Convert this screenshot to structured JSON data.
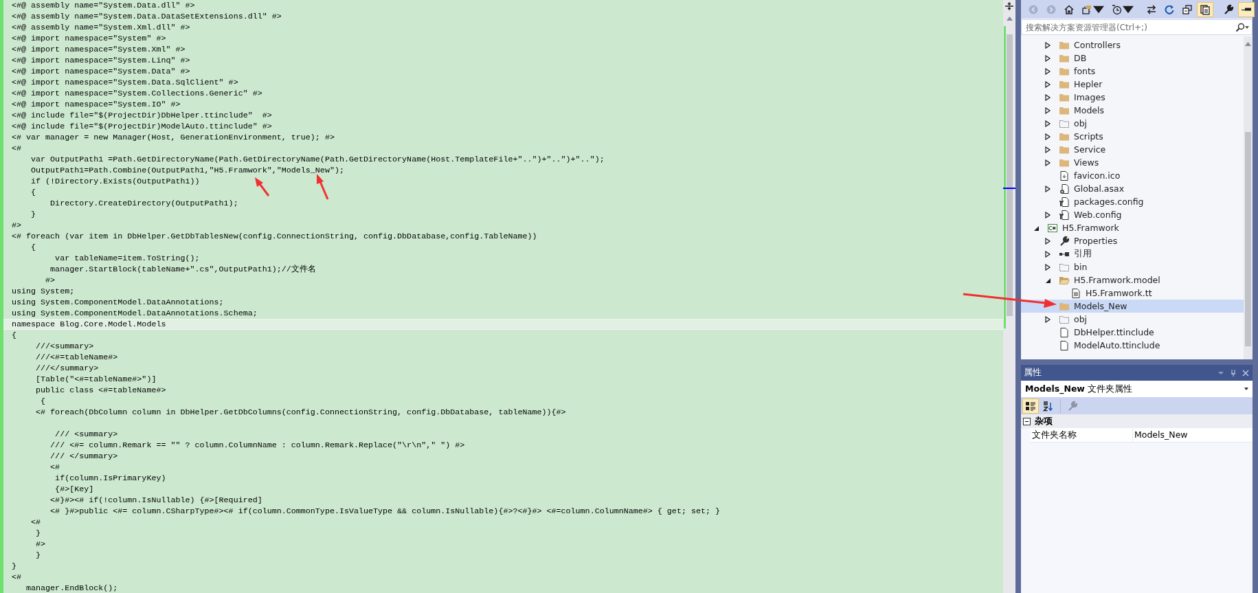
{
  "editor": {
    "lines": [
      {
        "text": "<#@ assembly name=\"System.Data.dll\" #>",
        "current": false
      },
      {
        "text": "<#@ assembly name=\"System.Data.DataSetExtensions.dll\" #>",
        "current": false
      },
      {
        "text": "<#@ assembly name=\"System.Xml.dll\" #>",
        "current": false
      },
      {
        "text": "<#@ import namespace=\"System\" #>",
        "current": false
      },
      {
        "text": "<#@ import namespace=\"System.Xml\" #>",
        "current": false
      },
      {
        "text": "<#@ import namespace=\"System.Linq\" #>",
        "current": false
      },
      {
        "text": "<#@ import namespace=\"System.Data\" #>",
        "current": false
      },
      {
        "text": "<#@ import namespace=\"System.Data.SqlClient\" #>",
        "current": false
      },
      {
        "text": "<#@ import namespace=\"System.Collections.Generic\" #>",
        "current": false
      },
      {
        "text": "<#@ import namespace=\"System.IO\" #>",
        "current": false
      },
      {
        "text": "<#@ include file=\"$(ProjectDir)DbHelper.ttinclude\"  #>",
        "current": false
      },
      {
        "text": "<#@ include file=\"$(ProjectDir)ModelAuto.ttinclude\" #>",
        "current": false
      },
      {
        "text": "<# var manager = new Manager(Host, GenerationEnvironment, true); #>",
        "current": false
      },
      {
        "text": "<#",
        "current": false
      },
      {
        "text": "    var OutputPath1 =Path.GetDirectoryName(Path.GetDirectoryName(Path.GetDirectoryName(Host.TemplateFile+\"..\")+\"..\")+\"..\");",
        "current": false
      },
      {
        "text": "    OutputPath1=Path.Combine(OutputPath1,\"H5.Framwork\",\"Models_New\");",
        "current": false
      },
      {
        "text": "    if (!Directory.Exists(OutputPath1))",
        "current": false
      },
      {
        "text": "    {",
        "current": false
      },
      {
        "text": "        Directory.CreateDirectory(OutputPath1);",
        "current": false
      },
      {
        "text": "    }",
        "current": false
      },
      {
        "text": "#>",
        "current": false
      },
      {
        "text": "<# foreach (var item in DbHelper.GetDbTablesNew(config.ConnectionString, config.DbDatabase,config.TableName))",
        "current": false
      },
      {
        "text": "    {",
        "current": false
      },
      {
        "text": "         var tableName=item.ToString();",
        "current": false
      },
      {
        "text": "        manager.StartBlock(tableName+\".cs\",OutputPath1);//文件名",
        "current": false
      },
      {
        "text": "       #>",
        "current": false
      },
      {
        "text": "using System;",
        "current": false
      },
      {
        "text": "using System.ComponentModel.DataAnnotations;",
        "current": false
      },
      {
        "text": "using System.ComponentModel.DataAnnotations.Schema;",
        "current": false
      },
      {
        "text": "namespace Blog.Core.Model.Models",
        "current": true
      },
      {
        "text": "{",
        "current": false
      },
      {
        "text": "     ///<summary>",
        "current": false
      },
      {
        "text": "     ///<#=tableName#>",
        "current": false
      },
      {
        "text": "     ///</summary>",
        "current": false
      },
      {
        "text": "     [Table(\"<#=tableName#>\")]",
        "current": false
      },
      {
        "text": "     public class <#=tableName#>",
        "current": false
      },
      {
        "text": "      {",
        "current": false
      },
      {
        "text": "     <# foreach(DbColumn column in DbHelper.GetDbColumns(config.ConnectionString, config.DbDatabase, tableName)){#>",
        "current": false
      },
      {
        "current": false
      },
      {
        "text": "         /// <summary>",
        "current": false
      },
      {
        "text": "        /// <#= column.Remark == \"\" ? column.ColumnName : column.Remark.Replace(\"\\r\\n\",\" \") #>",
        "current": false
      },
      {
        "text": "        /// </summary>",
        "current": false
      },
      {
        "text": "        <#",
        "current": false
      },
      {
        "text": "         if(column.IsPrimaryKey)",
        "current": false
      },
      {
        "text": "         {#>[Key]",
        "current": false
      },
      {
        "text": "        <#}#><# if(!column.IsNullable) {#>[Required]",
        "current": false
      },
      {
        "text": "        <# }#>public <#= column.CSharpType#><# if(column.CommonType.IsValueType && column.IsNullable){#>?<#}#> <#=column.ColumnName#> { get; set; }",
        "current": false
      },
      {
        "text": "    <#",
        "current": false
      },
      {
        "text": "     }",
        "current": false
      },
      {
        "text": "     #>",
        "current": false
      },
      {
        "text": "     }",
        "current": false
      },
      {
        "text": "}",
        "current": false
      },
      {
        "text": "<#",
        "current": false
      },
      {
        "text": "   manager.EndBlock();",
        "current": false
      }
    ]
  },
  "explorer": {
    "toolbar": [
      {
        "kind": "back",
        "disabled": true,
        "on": false
      },
      {
        "kind": "forward",
        "disabled": true,
        "on": false
      },
      {
        "kind": "home",
        "disabled": false,
        "on": false
      },
      {
        "kind": "sync",
        "disabled": false,
        "on": false
      },
      {
        "kind": "history",
        "disabled": false,
        "on": false
      },
      {
        "kind": "swap",
        "disabled": false,
        "on": false
      },
      {
        "kind": "refresh",
        "disabled": false,
        "on": false
      },
      {
        "kind": "collapse",
        "disabled": false,
        "on": false
      },
      {
        "kind": "show-all",
        "disabled": false,
        "on": true
      },
      {
        "kind": "properties",
        "disabled": false,
        "on": false
      },
      {
        "kind": "preview",
        "disabled": false,
        "on": true
      }
    ],
    "search": {
      "placeholder": "搜索解决方案资源管理器(Ctrl+;)"
    },
    "tree": [
      {
        "children": [
          {
            "label": "Controllers",
            "kind": "folder",
            "expanded": false,
            "selected": false
          },
          {
            "label": "DB",
            "kind": "folder",
            "expanded": false,
            "selected": false
          },
          {
            "label": "fonts",
            "kind": "folder",
            "expanded": false,
            "selected": false
          },
          {
            "label": "Hepler",
            "kind": "folder",
            "expanded": false,
            "selected": false
          },
          {
            "label": "Images",
            "kind": "folder",
            "expanded": false,
            "selected": false
          },
          {
            "label": "Models",
            "kind": "folder",
            "expanded": false,
            "selected": false
          },
          {
            "label": "obj",
            "kind": "hidden-folder",
            "expanded": false,
            "selected": false
          },
          {
            "label": "Scripts",
            "kind": "folder",
            "expanded": false,
            "selected": false
          },
          {
            "label": "Service",
            "kind": "folder",
            "expanded": false,
            "selected": false
          },
          {
            "label": "Views",
            "kind": "folder",
            "expanded": false,
            "selected": false
          },
          {
            "label": "favicon.ico",
            "kind": "image-file",
            "selected": false
          },
          {
            "label": "Global.asax",
            "kind": "gear-file",
            "expanded": false,
            "selected": false
          },
          {
            "label": "packages.config",
            "kind": "config-file",
            "selected": false
          },
          {
            "label": "Web.config",
            "kind": "config-file",
            "expanded": false,
            "selected": false
          }
        ]
      },
      {
        "label": "H5.Framwork",
        "kind": "project",
        "expanded": true,
        "selected": false,
        "children": [
          {
            "label": "Properties",
            "kind": "wrench",
            "expanded": false,
            "selected": false
          },
          {
            "label": "引用",
            "kind": "references",
            "expanded": false,
            "selected": false
          },
          {
            "label": "bin",
            "kind": "hidden-folder",
            "expanded": false,
            "selected": false
          },
          {
            "label": "H5.Framwork.model",
            "kind": "open-folder",
            "expanded": true,
            "selected": false,
            "children": [
              {
                "label": "H5.Framwork.tt",
                "kind": "text-file",
                "selected": false
              }
            ]
          },
          {
            "label": "Models_New",
            "kind": "folder",
            "selected": true
          },
          {
            "label": "obj",
            "kind": "hidden-folder",
            "expanded": false,
            "selected": false
          },
          {
            "label": "DbHelper.ttinclude",
            "kind": "file",
            "selected": false
          },
          {
            "label": "ModelAuto.ttinclude",
            "kind": "file",
            "selected": false
          }
        ]
      }
    ]
  },
  "properties": {
    "title": "属性",
    "object": "**Models_New** 文件夹属性",
    "toolbar": [
      {
        "kind": "categorized",
        "on": true,
        "disabled": false
      },
      {
        "kind": "alphabetical",
        "on": false,
        "disabled": false
      },
      {
        "kind": "property-pages",
        "on": false,
        "disabled": true
      }
    ],
    "categories": [
      {
        "name": "杂项",
        "expanded": true,
        "rows": [
          {
            "name": "文件夹名称",
            "value": "Models_New"
          }
        ]
      }
    ]
  }
}
